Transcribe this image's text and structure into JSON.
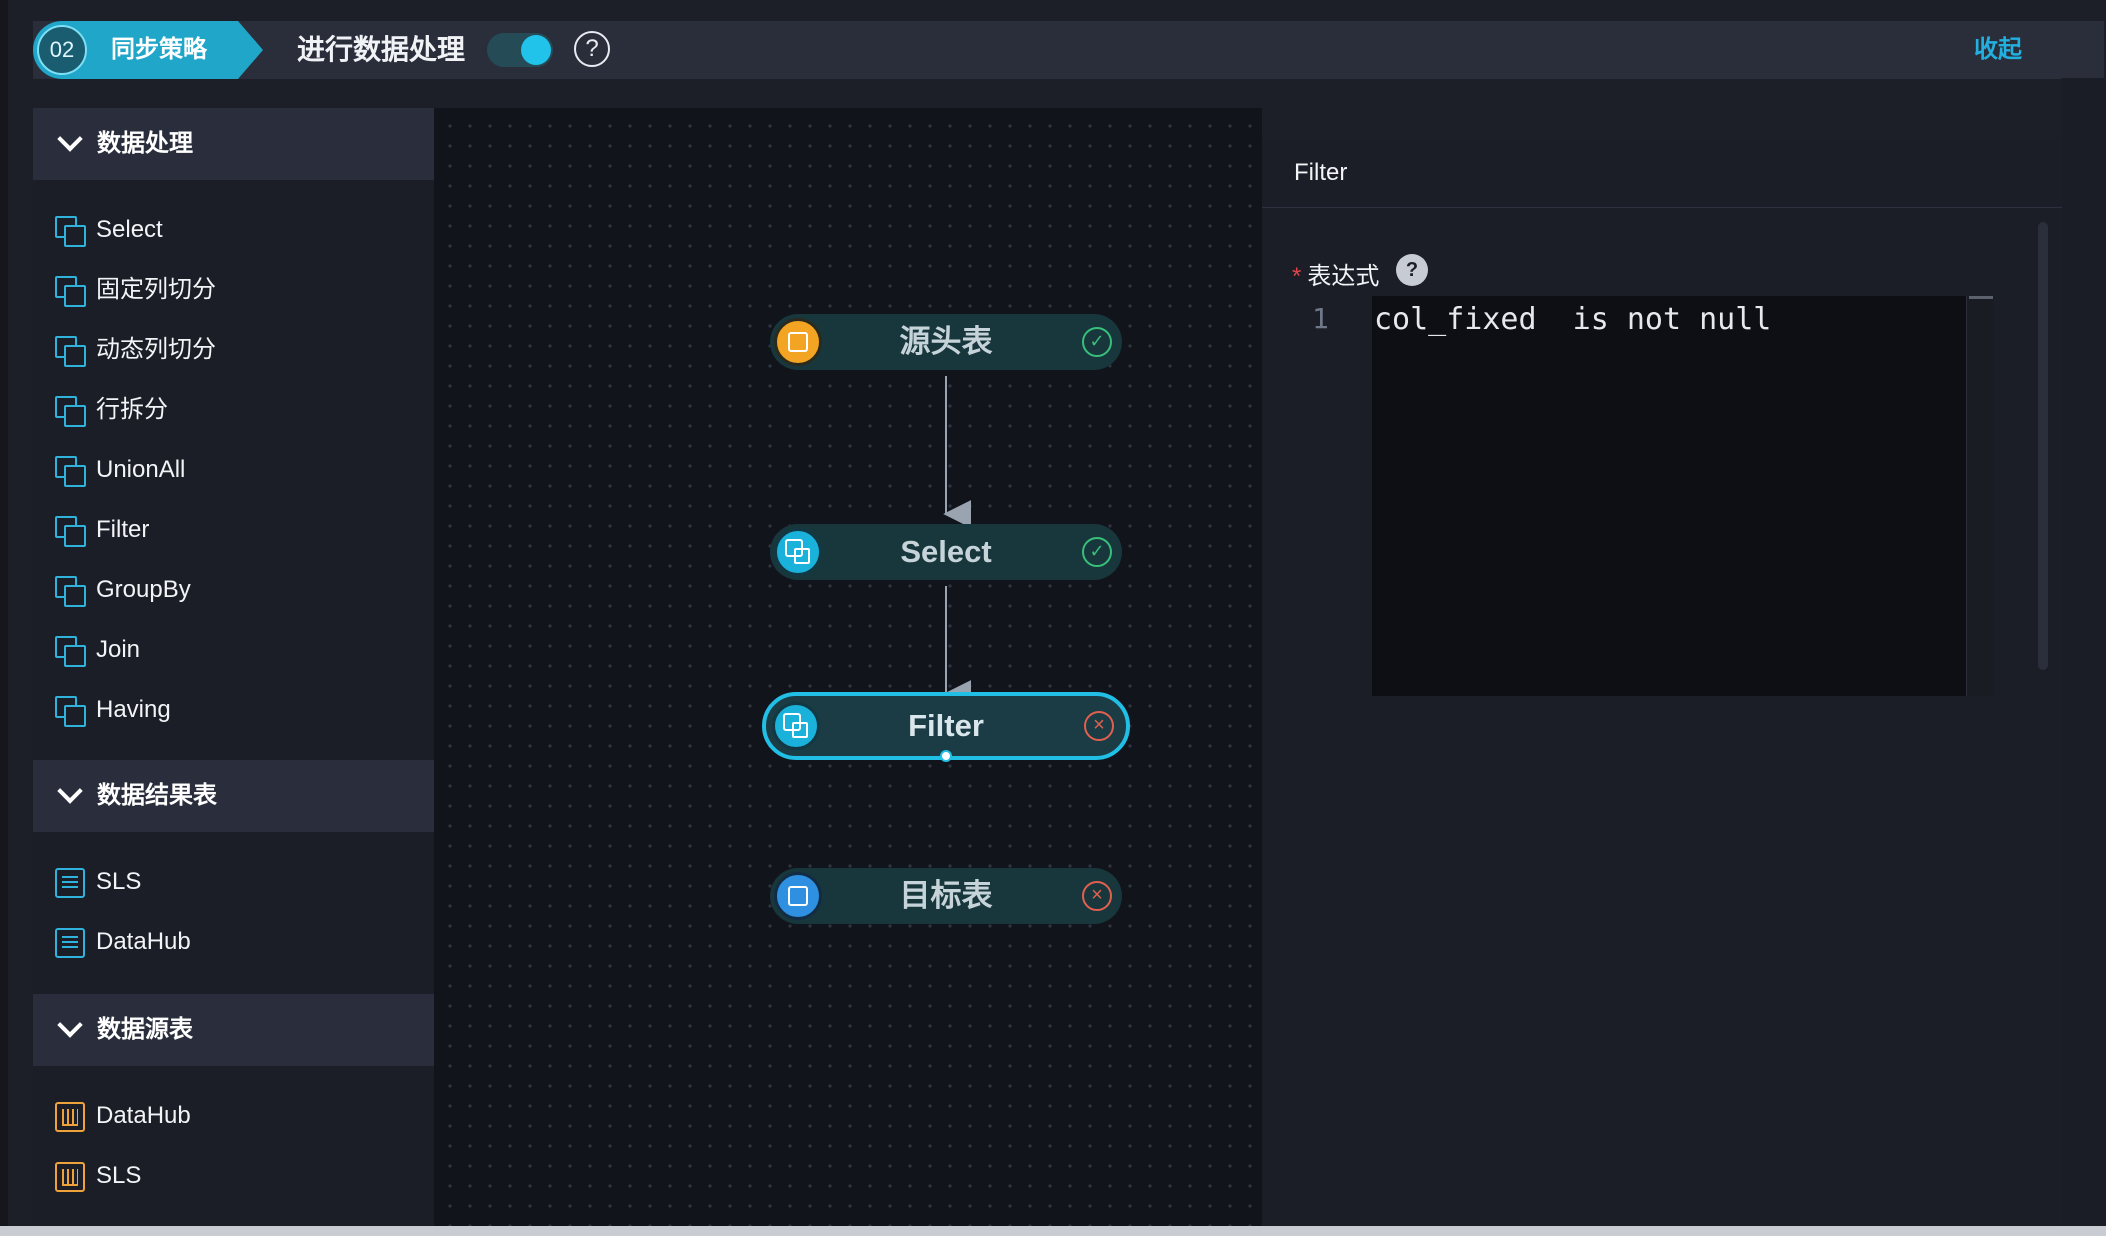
{
  "header": {
    "step_number": "02",
    "step_title": "同步策略",
    "process_label": "进行数据处理",
    "toggle_on": true,
    "help_symbol": "?",
    "collapse_label": "收起"
  },
  "sidebar": {
    "sections": [
      {
        "title": "数据处理",
        "items": [
          {
            "label": "Select",
            "icon": "copy-icon"
          },
          {
            "label": "固定列切分",
            "icon": "copy-icon"
          },
          {
            "label": "动态列切分",
            "icon": "copy-icon"
          },
          {
            "label": "行拆分",
            "icon": "copy-icon"
          },
          {
            "label": "UnionAll",
            "icon": "copy-icon"
          },
          {
            "label": "Filter",
            "icon": "copy-icon"
          },
          {
            "label": "GroupBy",
            "icon": "copy-icon"
          },
          {
            "label": "Join",
            "icon": "copy-icon"
          },
          {
            "label": "Having",
            "icon": "copy-icon"
          }
        ]
      },
      {
        "title": "数据结果表",
        "items": [
          {
            "label": "SLS",
            "icon": "list-icon"
          },
          {
            "label": "DataHub",
            "icon": "list-icon"
          }
        ]
      },
      {
        "title": "数据源表",
        "items": [
          {
            "label": "DataHub",
            "icon": "bar-chart-icon"
          },
          {
            "label": "SLS",
            "icon": "bar-chart-icon"
          }
        ]
      }
    ]
  },
  "canvas": {
    "nodes": [
      {
        "label": "源头表",
        "status": "success",
        "icon": "source-table-icon"
      },
      {
        "label": "Select",
        "status": "success",
        "icon": "copy-icon"
      },
      {
        "label": "Filter",
        "status": "error",
        "icon": "copy-icon",
        "selected": true
      },
      {
        "label": "目标表",
        "status": "error",
        "icon": "list-icon"
      }
    ]
  },
  "panel": {
    "title": "Filter",
    "field_label": "表达式",
    "required_mark": "*",
    "help_symbol": "?",
    "line_number": "1",
    "expression": "col_fixed  is not null"
  },
  "colors": {
    "accent": "#1fa6c8",
    "success": "#38c07a",
    "error": "#e0604f",
    "source_orange": "#f3a423"
  }
}
